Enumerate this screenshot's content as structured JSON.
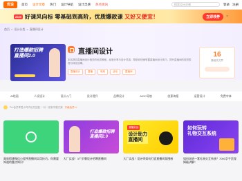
{
  "nav": {
    "logo": "优设",
    "links": [
      "首页",
      "设计文章",
      "热门",
      "设计导航",
      "设计灵感",
      "热点资讯",
      "立即查看"
    ],
    "search_placeholder": "搜索设计灵感",
    "right": [
      "登录",
      "注册"
    ]
  },
  "promo": {
    "tag": "2025",
    "text_a": "好课风向标",
    "text_b": "零基础到高阶，优质爆款课",
    "text_c": "又好又便宜！",
    "button": "立即领券",
    "close": "×"
  },
  "breadcrumb": [
    "首页",
    ">",
    "设计分类",
    ">",
    "直播间设计"
  ],
  "hero": {
    "title_line1": "打造爆款招聘",
    "title_line2": "直播间2.0"
  },
  "category": {
    "title": "直播间设计",
    "description": "本站提供直播间设计相关的优质教程、经验分享与设计灵感，帮助你快速掌握直播间设计技巧，提升直播间的视觉表现与转化效果。",
    "tags": [
      "直播设计",
      "直播",
      "电商",
      "活动",
      "直播间"
    ]
  },
  "stat": {
    "number": "16",
    "label": "篇相关文章"
  },
  "subcats": [
    "AI绘画",
    "人设设计",
    "设计入门",
    "设计提升",
    "品牌设计",
    "AIGC导航",
    "创意海报",
    "运营设计",
    "免费字体"
  ],
  "tip": {
    "text": "Pro会员享受小时内优先回复·一对一定制专属方案",
    "link": "升级会员>>"
  },
  "cards": [
    {
      "title": "高效搭建微信小程序直播间实用技巧，你需要知道的重点知识！"
    },
    {
      "title": "大厂实战！3个步骤设计招聘直播间"
    },
    {
      "title": "大厂实战！设计师如何打造直播间氛围感"
    },
    {
      "title": "如何玩转一套礼物交互系统？7000字干货保姆级讲解！"
    }
  ],
  "card_text": {
    "purple_line1": "打造爆款招聘",
    "purple_line2": "直播间2.0",
    "yellow_badge": "直播实战",
    "yellow_line1": "设计助力",
    "yellow_line2": "直播间",
    "violet_line1": "如何玩转",
    "violet_line2": "礼物交互系统"
  }
}
